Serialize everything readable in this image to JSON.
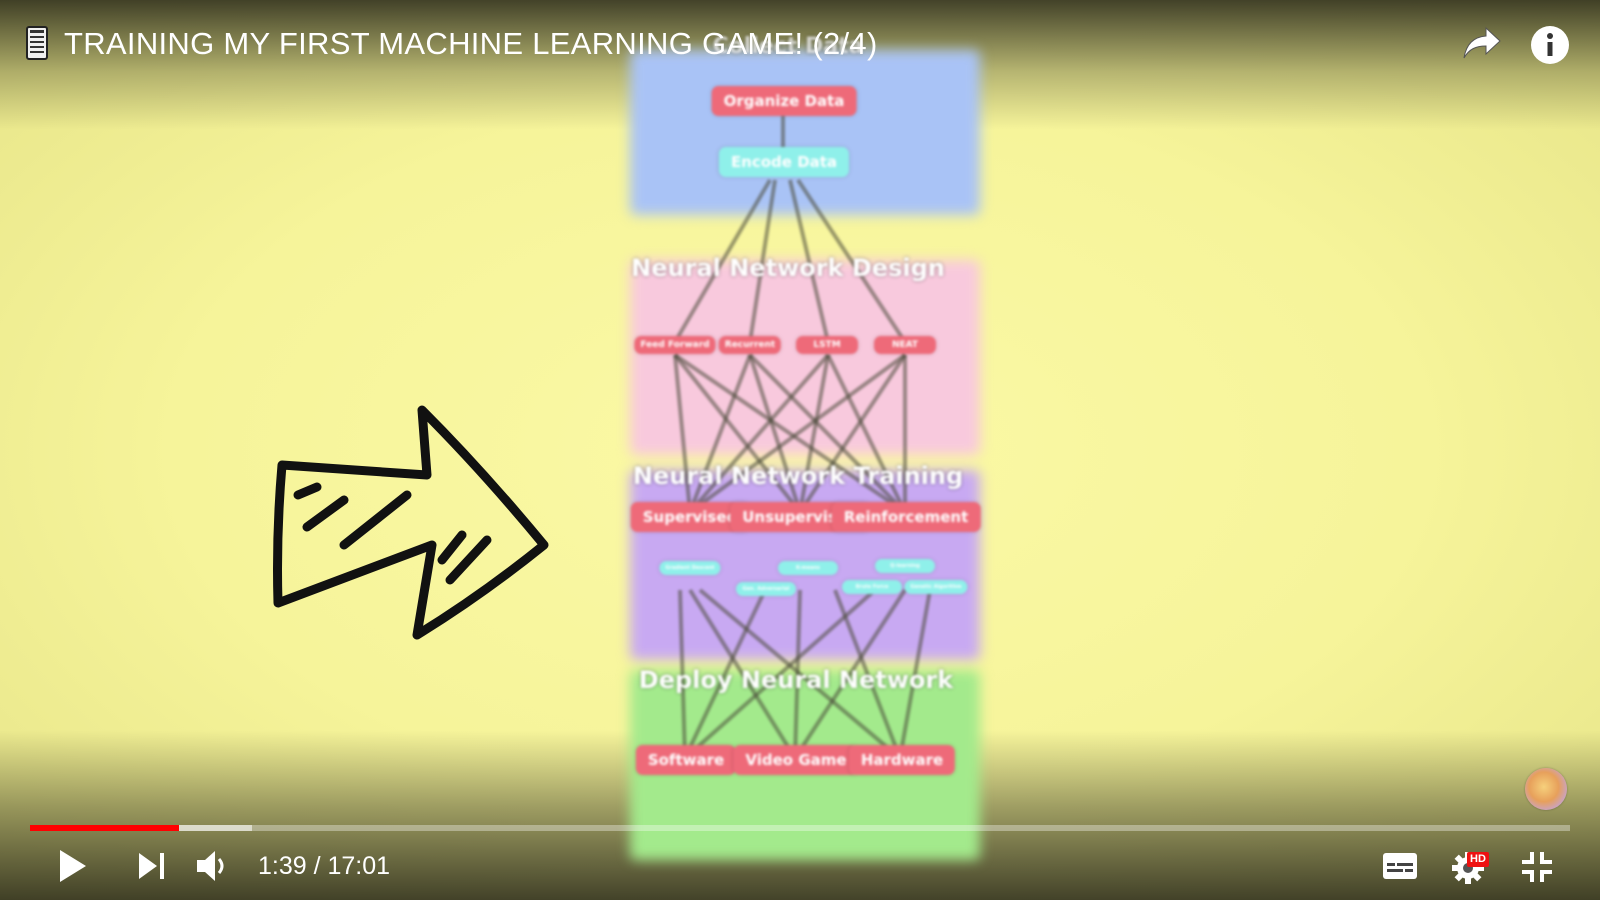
{
  "header": {
    "title": "TRAINING MY FIRST MACHINE LEARNING GAME! (2/4)",
    "icons": [
      "document-icon",
      "share-icon",
      "info-icon"
    ]
  },
  "diagram": {
    "collect": {
      "title": "Collect Data",
      "items": [
        "Organize Data",
        "Encode Data"
      ]
    },
    "design": {
      "title": "Neural Network Design",
      "items": [
        "Feed Forward",
        "Recurrent",
        "LSTM",
        "NEAT"
      ]
    },
    "training": {
      "title": "Neural Network Training",
      "items": [
        "Supervised",
        "Unsupervised",
        "Reinforcement"
      ],
      "sub_items": [
        "Gradient Descent",
        "K-means",
        "Q-learning",
        "Gen. Adversarial",
        "Brute Force",
        "Genetic Algorithm"
      ]
    },
    "deploy": {
      "title": "Deploy Neural Network",
      "items": [
        "Software",
        "Video Game",
        "Hardware"
      ]
    },
    "colors": {
      "pill": "#ee6a79",
      "pill_alt": "#8ff0ea",
      "blue": "#a9c3f6",
      "pink": "#f8c9dd",
      "purple": "#c8a9f2",
      "green": "#a3ea8c"
    }
  },
  "player": {
    "current_time": "1:39",
    "duration": "17:01",
    "time_text": "1:39 / 17:01",
    "progress_played": 0.097,
    "progress_buffered": 0.144,
    "hd_badge": "HD",
    "accent": "#ff0000"
  }
}
